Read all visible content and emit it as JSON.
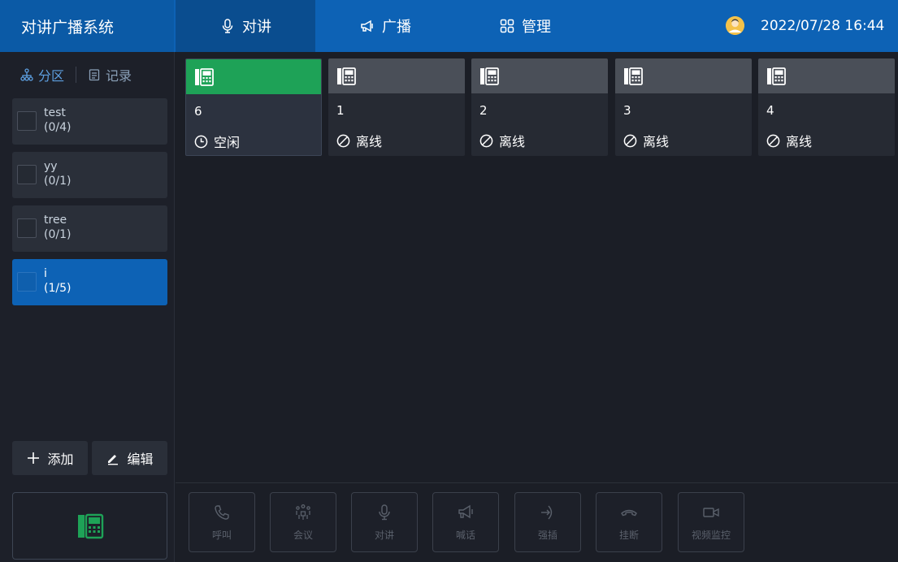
{
  "header": {
    "app_title": "对讲广播系统",
    "tabs": [
      {
        "label": "对讲",
        "icon": "microphone-icon",
        "active": true
      },
      {
        "label": "广播",
        "icon": "megaphone-icon",
        "active": false
      },
      {
        "label": "管理",
        "icon": "grid-icon",
        "active": false
      }
    ],
    "avatar_icon": "user-avatar-icon",
    "datetime": "2022/07/28 16:44"
  },
  "sidebar": {
    "tabs": [
      {
        "label": "分区",
        "icon": "org-tree-icon",
        "active": true
      },
      {
        "label": "记录",
        "icon": "clipboard-icon",
        "active": false
      }
    ],
    "groups": [
      {
        "name": "test",
        "count": "(0/4)",
        "checked": false,
        "active": false
      },
      {
        "name": "yy",
        "count": "(0/1)",
        "checked": false,
        "active": false
      },
      {
        "name": "tree",
        "count": "(0/1)",
        "checked": false,
        "active": false
      },
      {
        "name": "i",
        "count": "(1/5)",
        "checked": false,
        "active": true
      }
    ],
    "add_label": "添加",
    "edit_label": "编辑",
    "terminal_icon": "intercom-terminal-icon"
  },
  "devices": [
    {
      "id": "6",
      "status": "空闲",
      "status_icon": "clock-icon",
      "online": true
    },
    {
      "id": "1",
      "status": "离线",
      "status_icon": "offline-icon",
      "online": false
    },
    {
      "id": "2",
      "status": "离线",
      "status_icon": "offline-icon",
      "online": false
    },
    {
      "id": "3",
      "status": "离线",
      "status_icon": "offline-icon",
      "online": false
    },
    {
      "id": "4",
      "status": "离线",
      "status_icon": "offline-icon",
      "online": false
    }
  ],
  "actions": [
    {
      "label": "呼叫",
      "icon": "phone-icon",
      "enabled": false
    },
    {
      "label": "会议",
      "icon": "meeting-icon",
      "enabled": false
    },
    {
      "label": "对讲",
      "icon": "microphone-icon",
      "enabled": false
    },
    {
      "label": "喊话",
      "icon": "megaphone-icon",
      "enabled": false
    },
    {
      "label": "强插",
      "icon": "barge-in-icon",
      "enabled": false
    },
    {
      "label": "挂断",
      "icon": "hangup-icon",
      "enabled": false
    },
    {
      "label": "视频监控",
      "icon": "video-camera-icon",
      "enabled": false
    }
  ],
  "colors": {
    "header_blue": "#0d62b5",
    "active_tab": "#0a4d8f",
    "background": "#1b1e26",
    "online_green": "#1ea257",
    "offline_gray": "#4a4f58",
    "sidebar_active": "#0d62b5"
  }
}
